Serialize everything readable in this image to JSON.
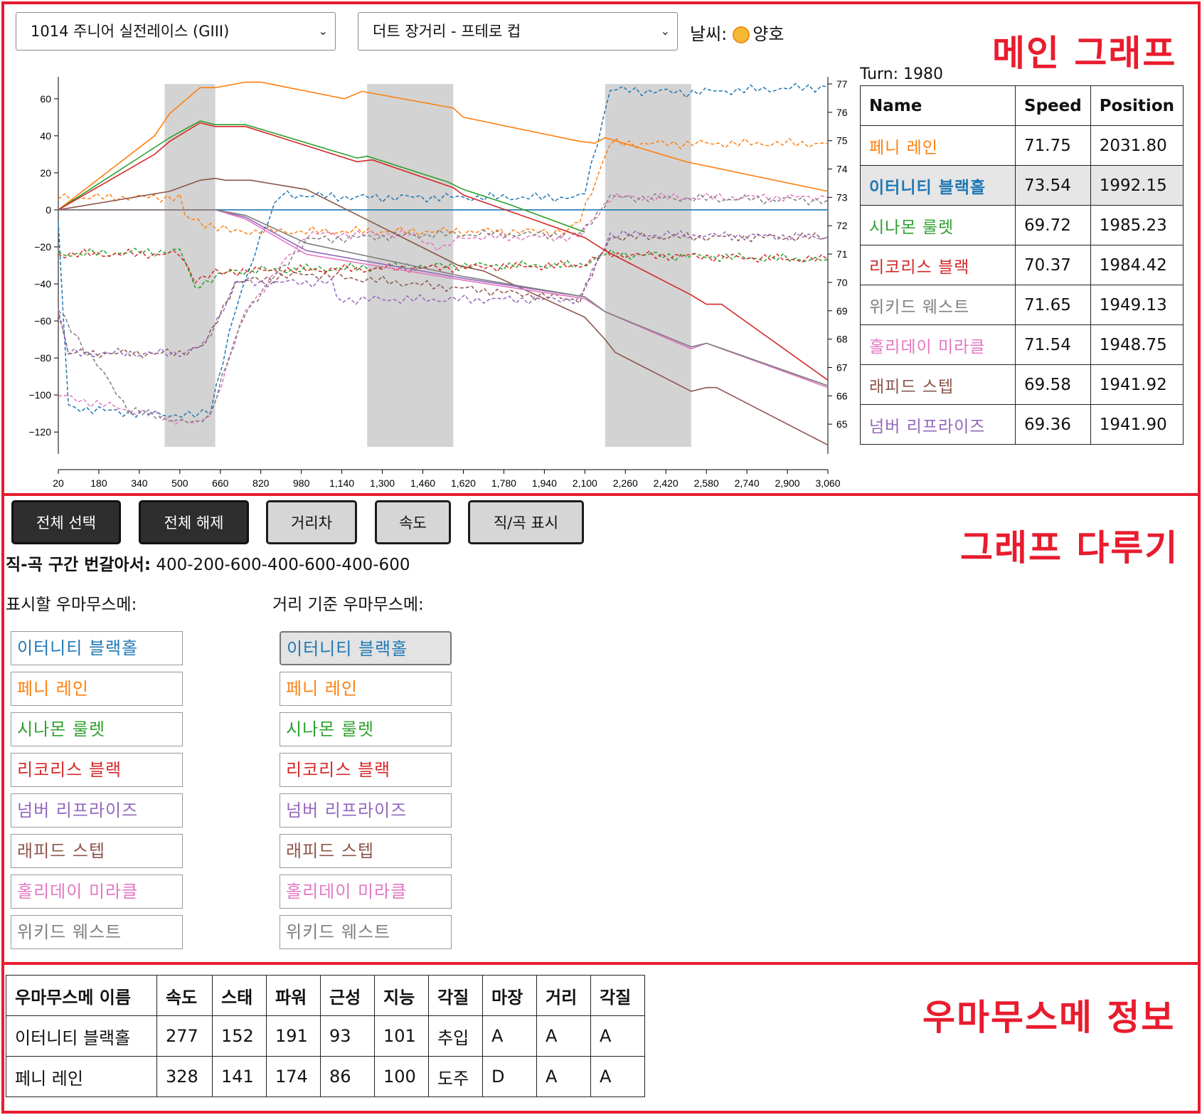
{
  "panels": {
    "main_graph": "메인 그래프",
    "graph_controls": "그래프 다루기",
    "umamusume_info": "우마무스메 정보"
  },
  "race_select": {
    "value": "1014 주니어 실전레이스 (GIII)"
  },
  "track_select": {
    "value": "더트 장거리 - 프테로 컵"
  },
  "weather": {
    "label": "날씨:",
    "icon": "sun-icon",
    "value": "양호"
  },
  "ranking": {
    "turn": "Turn: 1980",
    "headers": [
      "Name",
      "Speed",
      "Position"
    ],
    "rows": [
      {
        "name": "페니 레인",
        "speed": "71.75",
        "position": "2031.80",
        "color": "#ff7f0e"
      },
      {
        "name": "이터니티 블랙홀",
        "speed": "73.54",
        "position": "1992.15",
        "color": "#1f77b4",
        "highlight": true
      },
      {
        "name": "시나몬 룰렛",
        "speed": "69.72",
        "position": "1985.23",
        "color": "#2ca02c"
      },
      {
        "name": "리코리스 블랙",
        "speed": "70.37",
        "position": "1984.42",
        "color": "#d62728"
      },
      {
        "name": "위키드 웨스트",
        "speed": "71.65",
        "position": "1949.13",
        "color": "#7f7f7f"
      },
      {
        "name": "홀리데이 미라클",
        "speed": "71.54",
        "position": "1948.75",
        "color": "#e377c2"
      },
      {
        "name": "래피드 스텝",
        "speed": "69.58",
        "position": "1941.92",
        "color": "#8c564b"
      },
      {
        "name": "넘버 리프라이즈",
        "speed": "69.36",
        "position": "1941.90",
        "color": "#9467bd"
      }
    ]
  },
  "buttons": {
    "select_all": "전체 선택",
    "deselect_all": "전체 해제",
    "distance_gap": "거리차",
    "speed": "속도",
    "straight_curve": "직/곡 표시"
  },
  "alternation": {
    "label": "직-곡 구간 번갈아서:",
    "value": "400-200-600-400-600-400-600"
  },
  "display_list": {
    "label": "표시할 우마무스메:",
    "items": [
      {
        "name": "이터니티 블랙홀",
        "color": "#1f77b4"
      },
      {
        "name": "페니 레인",
        "color": "#ff7f0e"
      },
      {
        "name": "시나몬 룰렛",
        "color": "#2ca02c"
      },
      {
        "name": "리코리스 블랙",
        "color": "#d62728"
      },
      {
        "name": "넘버 리프라이즈",
        "color": "#9467bd"
      },
      {
        "name": "래피드 스텝",
        "color": "#8c564b"
      },
      {
        "name": "홀리데이 미라클",
        "color": "#e377c2"
      },
      {
        "name": "위키드 웨스트",
        "color": "#7f7f7f"
      }
    ]
  },
  "reference_list": {
    "label": "거리 기준 우마무스메:",
    "selected": "이터니티 블랙홀",
    "items": [
      {
        "name": "이터니티 블랙홀",
        "color": "#1f77b4"
      },
      {
        "name": "페니 레인",
        "color": "#ff7f0e"
      },
      {
        "name": "시나몬 룰렛",
        "color": "#2ca02c"
      },
      {
        "name": "리코리스 블랙",
        "color": "#d62728"
      },
      {
        "name": "넘버 리프라이즈",
        "color": "#9467bd"
      },
      {
        "name": "래피드 스텝",
        "color": "#8c564b"
      },
      {
        "name": "홀리데이 미라클",
        "color": "#e377c2"
      },
      {
        "name": "위키드 웨스트",
        "color": "#7f7f7f"
      }
    ]
  },
  "info_table": {
    "headers": [
      "우마무스메 이름",
      "속도",
      "스태",
      "파워",
      "근성",
      "지능",
      "각질",
      "마장",
      "거리",
      "각질"
    ],
    "rows": [
      [
        "이터니티 블랙홀",
        "277",
        "152",
        "191",
        "93",
        "101",
        "추입",
        "A",
        "A",
        "A"
      ],
      [
        "페니 레인",
        "328",
        "141",
        "174",
        "86",
        "100",
        "도주",
        "D",
        "A",
        "A"
      ]
    ]
  },
  "chart_data": {
    "type": "line",
    "x_ticks": [
      "20",
      "180",
      "340",
      "500",
      "660",
      "820",
      "980",
      "1,140",
      "1,300",
      "1,460",
      "1,620",
      "1,780",
      "1,940",
      "2,100",
      "2,260",
      "2,420",
      "2,580",
      "2,740",
      "2,900",
      "3,060"
    ],
    "xlim": [
      20,
      3060
    ],
    "y_left": {
      "label": "",
      "ylim": [
        -128,
        68
      ],
      "ticks": [
        "60",
        "40",
        "20",
        "0",
        "−20",
        "−40",
        "−60",
        "−80",
        "−100",
        "−120"
      ]
    },
    "y_right": {
      "label": "",
      "ylim": [
        64.2,
        77
      ],
      "ticks": [
        "77",
        "76",
        "75",
        "74",
        "73",
        "72",
        "71",
        "70",
        "69",
        "68",
        "67",
        "66",
        "65"
      ]
    },
    "shaded_ranges": [
      [
        440,
        640
      ],
      [
        1240,
        1580
      ],
      [
        2180,
        2520
      ]
    ],
    "distance_series": [
      {
        "name": "이터니티 블랙홀",
        "color": "#1f77b4",
        "points": [
          [
            20,
            0
          ],
          [
            3060,
            0
          ]
        ]
      },
      {
        "name": "페니 레인",
        "color": "#ff7f0e",
        "points": [
          [
            20,
            0
          ],
          [
            400,
            40
          ],
          [
            460,
            52
          ],
          [
            580,
            66
          ],
          [
            640,
            66
          ],
          [
            760,
            69
          ],
          [
            820,
            69
          ],
          [
            1150,
            60
          ],
          [
            1220,
            64
          ],
          [
            1580,
            55
          ],
          [
            1620,
            50
          ],
          [
            2080,
            37
          ],
          [
            2140,
            36
          ],
          [
            2180,
            39
          ],
          [
            2500,
            26
          ],
          [
            3060,
            10
          ]
        ]
      },
      {
        "name": "시나몬 룰렛",
        "color": "#2ca02c",
        "points": [
          [
            20,
            0
          ],
          [
            460,
            39
          ],
          [
            580,
            48
          ],
          [
            640,
            46
          ],
          [
            760,
            46
          ],
          [
            1200,
            28
          ],
          [
            1240,
            29
          ],
          [
            1560,
            15
          ],
          [
            1620,
            11
          ],
          [
            1800,
            3
          ],
          [
            2100,
            -12
          ]
        ]
      },
      {
        "name": "리코리스 블랙",
        "color": "#d62728",
        "points": [
          [
            20,
            0
          ],
          [
            400,
            30
          ],
          [
            460,
            37
          ],
          [
            580,
            47
          ],
          [
            640,
            45
          ],
          [
            760,
            45
          ],
          [
            1200,
            26
          ],
          [
            1260,
            27
          ],
          [
            1580,
            12
          ],
          [
            1620,
            8
          ],
          [
            2100,
            -15
          ],
          [
            2180,
            -22
          ],
          [
            2520,
            -46
          ],
          [
            2580,
            -51
          ],
          [
            2640,
            -51
          ],
          [
            3060,
            -92
          ]
        ]
      },
      {
        "name": "래피드 스텝",
        "color": "#8c564b",
        "points": [
          [
            20,
            0
          ],
          [
            460,
            10
          ],
          [
            580,
            16
          ],
          [
            640,
            17
          ],
          [
            680,
            16
          ],
          [
            780,
            16
          ],
          [
            1000,
            11
          ],
          [
            1600,
            -30
          ],
          [
            1700,
            -33
          ],
          [
            2100,
            -58
          ],
          [
            2180,
            -70
          ],
          [
            2220,
            -77
          ],
          [
            2520,
            -98
          ],
          [
            2580,
            -96
          ],
          [
            2620,
            -96
          ],
          [
            3060,
            -127
          ]
        ]
      },
      {
        "name": "넘버 리프라이즈",
        "color": "#9467bd",
        "points": [
          [
            20,
            0
          ],
          [
            640,
            0
          ],
          [
            760,
            -4
          ],
          [
            1000,
            -22
          ],
          [
            1620,
            -37
          ],
          [
            2100,
            -47
          ],
          [
            2180,
            -55
          ],
          [
            2520,
            -75
          ],
          [
            2580,
            -72
          ],
          [
            3060,
            -95
          ]
        ]
      },
      {
        "name": "홀리데이 미라클",
        "color": "#e377c2",
        "points": [
          [
            20,
            0
          ],
          [
            640,
            0
          ],
          [
            760,
            -5
          ],
          [
            1000,
            -24
          ],
          [
            1620,
            -38
          ],
          [
            2100,
            -48
          ],
          [
            2180,
            -55
          ],
          [
            2520,
            -75
          ],
          [
            2580,
            -72
          ],
          [
            3060,
            -96
          ]
        ]
      },
      {
        "name": "위키드 웨스트",
        "color": "#7f7f7f",
        "points": [
          [
            20,
            0
          ],
          [
            640,
            0
          ],
          [
            760,
            -3
          ],
          [
            1000,
            -18
          ],
          [
            1620,
            -36
          ],
          [
            2100,
            -47
          ],
          [
            2180,
            -55
          ],
          [
            2520,
            -74
          ],
          [
            2580,
            -72
          ],
          [
            3060,
            -95
          ]
        ]
      }
    ],
    "speed_series": [
      {
        "name": "이터니티 블랙홀",
        "color": "#1f77b4",
        "points": [
          [
            20,
            72
          ],
          [
            60,
            65.6
          ],
          [
            300,
            65.4
          ],
          [
            560,
            65.3
          ],
          [
            620,
            65.5
          ],
          [
            720,
            69
          ],
          [
            820,
            71.7
          ],
          [
            900,
            73.1
          ],
          [
            1200,
            73.0
          ],
          [
            1500,
            73.0
          ],
          [
            2080,
            73.0
          ],
          [
            2100,
            73.2
          ],
          [
            2200,
            76.8
          ],
          [
            2500,
            76.7
          ],
          [
            3060,
            76.9
          ]
        ]
      },
      {
        "name": "페니 레인",
        "color": "#ff7f0e",
        "points": [
          [
            20,
            73
          ],
          [
            500,
            73
          ],
          [
            520,
            72.3
          ],
          [
            700,
            71.8
          ],
          [
            2040,
            71.8
          ],
          [
            2080,
            72.2
          ],
          [
            2200,
            74.9
          ],
          [
            3060,
            74.9
          ]
        ]
      },
      {
        "name": "시나몬 룰렛",
        "color": "#2ca02c",
        "points": [
          [
            20,
            71
          ],
          [
            500,
            71.1
          ],
          [
            560,
            69.9
          ],
          [
            600,
            70
          ],
          [
            700,
            70.4
          ],
          [
            1600,
            70.6
          ],
          [
            2080,
            70.6
          ],
          [
            2180,
            71
          ],
          [
            3060,
            70.8
          ]
        ]
      },
      {
        "name": "리코리스 블랙",
        "color": "#d62728",
        "points": [
          [
            20,
            71
          ],
          [
            500,
            71
          ],
          [
            560,
            70.1
          ],
          [
            640,
            70.3
          ],
          [
            700,
            70.4
          ],
          [
            2080,
            70.6
          ],
          [
            2180,
            71
          ],
          [
            3060,
            70.8
          ]
        ]
      },
      {
        "name": "래피드 스텝",
        "color": "#8c564b",
        "points": [
          [
            20,
            69
          ],
          [
            60,
            67.5
          ],
          [
            500,
            67.5
          ],
          [
            600,
            67.8
          ],
          [
            720,
            70
          ],
          [
            1000,
            70.3
          ],
          [
            2080,
            69.4
          ],
          [
            2200,
            71.6
          ],
          [
            3060,
            71.6
          ]
        ]
      },
      {
        "name": "넘버 리프라이즈",
        "color": "#9467bd",
        "points": [
          [
            20,
            69
          ],
          [
            60,
            67.5
          ],
          [
            500,
            67.5
          ],
          [
            600,
            67.8
          ],
          [
            720,
            70
          ],
          [
            1100,
            70
          ],
          [
            1120,
            69.4
          ],
          [
            2080,
            69.4
          ],
          [
            2200,
            71.7
          ],
          [
            3060,
            71.6
          ]
        ]
      },
      {
        "name": "홀리데이 미라클",
        "color": "#e377c2",
        "points": [
          [
            20,
            66
          ],
          [
            300,
            65.5
          ],
          [
            560,
            65
          ],
          [
            620,
            65.3
          ],
          [
            760,
            69
          ],
          [
            1000,
            71.7
          ],
          [
            1400,
            71.7
          ],
          [
            1540,
            71.2
          ],
          [
            1620,
            71.6
          ],
          [
            2080,
            71.6
          ],
          [
            2200,
            73
          ],
          [
            3060,
            73
          ]
        ]
      },
      {
        "name": "위키드 웨스트",
        "color": "#7f7f7f",
        "points": [
          [
            20,
            69
          ],
          [
            300,
            65.5
          ],
          [
            560,
            65
          ],
          [
            620,
            65.4
          ],
          [
            760,
            69
          ],
          [
            1000,
            71.5
          ],
          [
            1500,
            71.7
          ],
          [
            2080,
            71.7
          ],
          [
            2200,
            73
          ],
          [
            3060,
            72.9
          ]
        ]
      }
    ]
  }
}
